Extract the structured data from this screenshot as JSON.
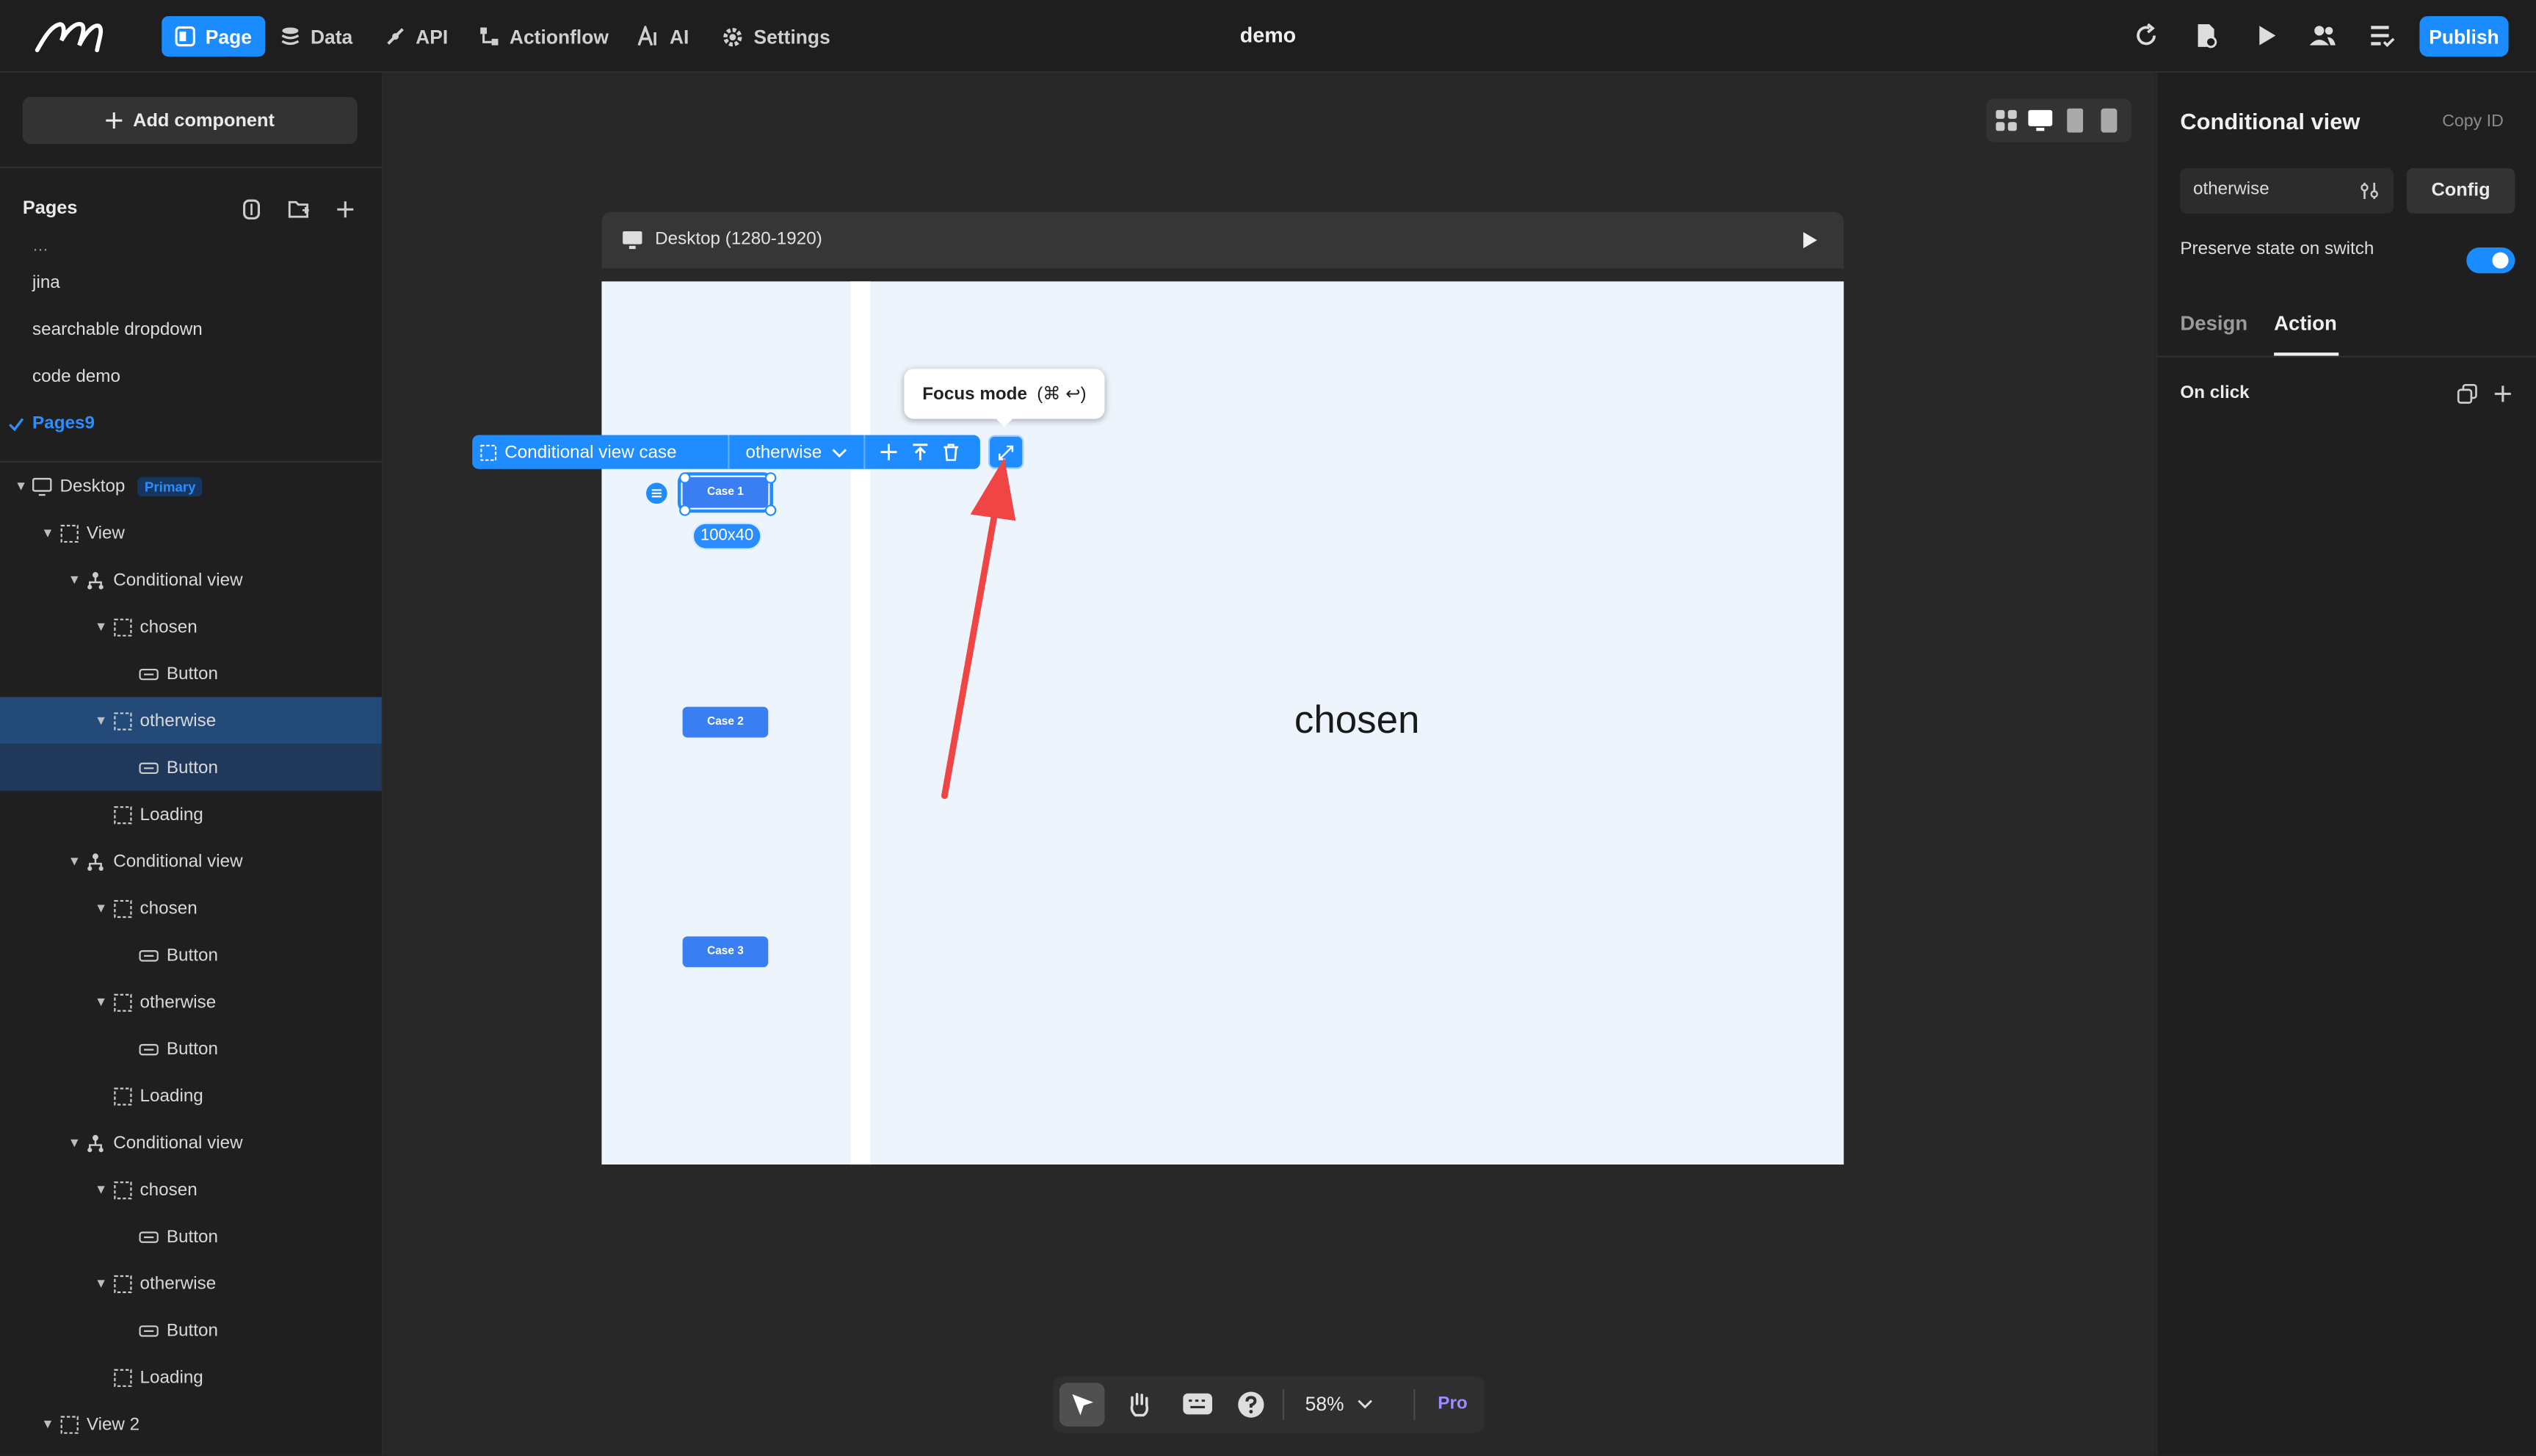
{
  "topbar": {
    "nav": [
      {
        "label": "Page",
        "icon": "page-icon",
        "active": true
      },
      {
        "label": "Data",
        "icon": "database-icon"
      },
      {
        "label": "API",
        "icon": "api-icon"
      },
      {
        "label": "Actionflow",
        "icon": "actionflow-icon"
      },
      {
        "label": "AI",
        "icon": "ai-icon"
      },
      {
        "label": "Settings",
        "icon": "gear-icon"
      }
    ],
    "title": "demo",
    "publish_label": "Publish"
  },
  "sidebar": {
    "add_component_label": "Add component",
    "pages_header": "Pages",
    "pages": [
      "jina",
      "searchable dropdown",
      "code demo",
      "Pages9"
    ],
    "active_page": "Pages9",
    "tree": [
      {
        "label": "Desktop",
        "badge": "Primary"
      },
      {
        "label": "View"
      },
      {
        "label": "Conditional view"
      },
      {
        "label": "chosen"
      },
      {
        "label": "Button"
      },
      {
        "label": "otherwise"
      },
      {
        "label": "Button"
      },
      {
        "label": "Loading"
      },
      {
        "label": "Conditional view"
      },
      {
        "label": "chosen"
      },
      {
        "label": "Button"
      },
      {
        "label": "otherwise"
      },
      {
        "label": "Button"
      },
      {
        "label": "Loading"
      },
      {
        "label": "Conditional view"
      },
      {
        "label": "chosen"
      },
      {
        "label": "Button"
      },
      {
        "label": "otherwise"
      },
      {
        "label": "Button"
      },
      {
        "label": "Loading"
      },
      {
        "label": "View 2"
      }
    ]
  },
  "canvas": {
    "frame_title": "Desktop (1280-1920)",
    "toolbar": {
      "component_label": "Conditional view case",
      "case_select": "otherwise"
    },
    "tooltip": "Focus mode",
    "tooltip_shortcut": "(⌘ ↩)",
    "size_label": "100x40",
    "cases": [
      "Case 1",
      "Case 2",
      "Case 3"
    ],
    "content_text": "chosen"
  },
  "bottombar": {
    "zoom": "58%",
    "pro_label": "Pro"
  },
  "rightpanel": {
    "title": "Conditional view",
    "copy_id_label": "Copy ID",
    "case_value": "otherwise",
    "config_label": "Config",
    "preserve_label": "Preserve state on switch",
    "tabs": [
      "Design",
      "Action"
    ],
    "active_tab": "Action",
    "on_click_label": "On click"
  },
  "colors": {
    "accent": "#1a8cff",
    "annotation_arrow": "#f04545",
    "selection": "#234a78"
  }
}
